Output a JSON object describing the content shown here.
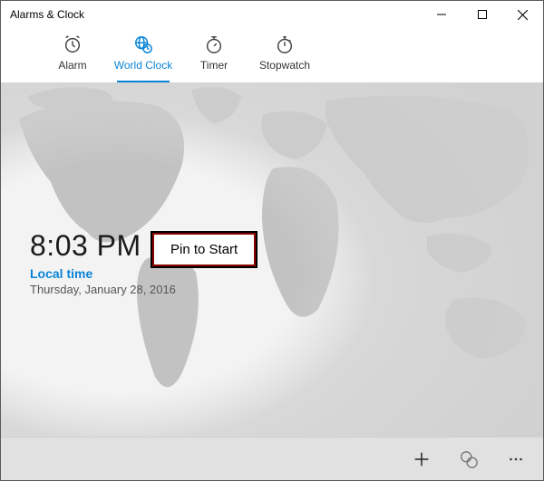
{
  "window": {
    "title": "Alarms & Clock"
  },
  "tabs": [
    {
      "label": "Alarm"
    },
    {
      "label": "World Clock"
    },
    {
      "label": "Timer"
    },
    {
      "label": "Stopwatch"
    }
  ],
  "active_tab_index": 1,
  "clock": {
    "time": "8:03 PM",
    "label": "Local time",
    "date": "Thursday, January 28, 2016"
  },
  "context_menu": {
    "items": [
      {
        "label": "Pin to Start"
      }
    ]
  },
  "colors": {
    "accent": "#0a84d6"
  }
}
